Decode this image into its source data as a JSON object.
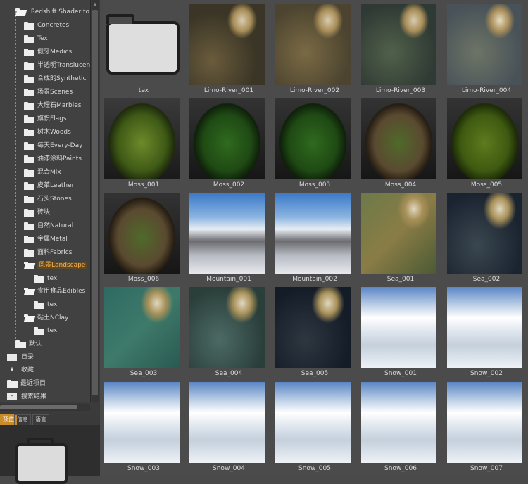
{
  "tree": {
    "root_label": "Redshift Shader to C",
    "items": [
      {
        "label": "Concretes"
      },
      {
        "label": "Tex"
      },
      {
        "label": "假牙Medics"
      },
      {
        "label": "半透明Translucen"
      },
      {
        "label": "合成的Synthetic"
      },
      {
        "label": "场景Scenes"
      },
      {
        "label": "大理石Marbles"
      },
      {
        "label": "旗帜Flags"
      },
      {
        "label": "树木Woods"
      },
      {
        "label": "每天Every-Day"
      },
      {
        "label": "油漆涂料Paints"
      },
      {
        "label": "混合Mix"
      },
      {
        "label": "皮革Leather"
      },
      {
        "label": "石头Stones"
      },
      {
        "label": "砖块"
      },
      {
        "label": "自然Natural"
      },
      {
        "label": "金属Metal"
      },
      {
        "label": "面料Fabrics"
      },
      {
        "label": "风景Landscape"
      },
      {
        "label": "tex"
      },
      {
        "label": "食用食品Edibles"
      },
      {
        "label": "tex"
      },
      {
        "label": "黏土NClay"
      },
      {
        "label": "tex"
      },
      {
        "label": "默认"
      }
    ],
    "special": [
      {
        "label": "目录",
        "icon": "book-icon"
      },
      {
        "label": "收藏",
        "icon": "star-icon"
      },
      {
        "label": "最近项目",
        "icon": "folder-icon"
      },
      {
        "label": "搜索结果",
        "icon": "search-icon"
      }
    ]
  },
  "bottom_tabs": [
    "预览",
    "信息",
    "语言"
  ],
  "grid": {
    "items": [
      {
        "name": "tex",
        "kind": "folder"
      },
      {
        "name": "Limo-River_001",
        "kind": "water"
      },
      {
        "name": "Limo-River_002",
        "kind": "water r2"
      },
      {
        "name": "Limo-River_003",
        "kind": "water r3"
      },
      {
        "name": "Limo-River_004",
        "kind": "water r4"
      },
      {
        "name": "Moss_001",
        "kind": "moss"
      },
      {
        "name": "Moss_002",
        "kind": "moss d"
      },
      {
        "name": "Moss_003",
        "kind": "moss d"
      },
      {
        "name": "Moss_004",
        "kind": "moss b"
      },
      {
        "name": "Moss_005",
        "kind": "moss y"
      },
      {
        "name": "Moss_006",
        "kind": "moss b"
      },
      {
        "name": "Mountain_001",
        "kind": "mountain"
      },
      {
        "name": "Mountain_002",
        "kind": "mountain"
      },
      {
        "name": "Sea_001",
        "kind": "sea1"
      },
      {
        "name": "Sea_002",
        "kind": "sea2"
      },
      {
        "name": "Sea_003",
        "kind": "sea3"
      },
      {
        "name": "Sea_004",
        "kind": "sea4"
      },
      {
        "name": "Sea_005",
        "kind": "sea5"
      },
      {
        "name": "Snow_001",
        "kind": "snow"
      },
      {
        "name": "Snow_002",
        "kind": "snow"
      },
      {
        "name": "Snow_003",
        "kind": "snow"
      },
      {
        "name": "Snow_004",
        "kind": "snow"
      },
      {
        "name": "Snow_005",
        "kind": "snow"
      },
      {
        "name": "Snow_006",
        "kind": "snow"
      },
      {
        "name": "Snow_007",
        "kind": "snow"
      }
    ]
  }
}
